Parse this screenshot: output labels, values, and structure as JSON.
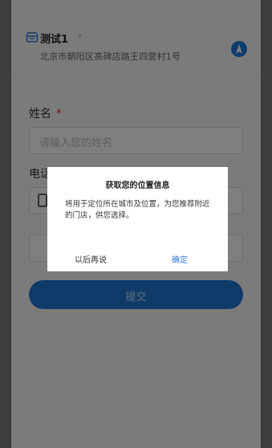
{
  "store": {
    "name": "测试1",
    "chevron": "›",
    "address": "北京市朝阳区高碑店路王四营村1号",
    "icon": "store-icon",
    "nav_icon": "navigation-icon"
  },
  "form": {
    "name_label": "姓名",
    "required_mark": "*",
    "name_placeholder": "请输入您的姓名",
    "phone_label": "电话",
    "submit_label": "提交"
  },
  "dialog": {
    "title": "获取您的位置信息",
    "body": "将用于定位所在城市及位置，为您推荐附近的门店，供您选择。",
    "cancel_label": "以后再说",
    "confirm_label": "确定"
  },
  "colors": {
    "accent": "#1f77d6",
    "required": "#d6302b",
    "link": "#2f7bd9"
  }
}
